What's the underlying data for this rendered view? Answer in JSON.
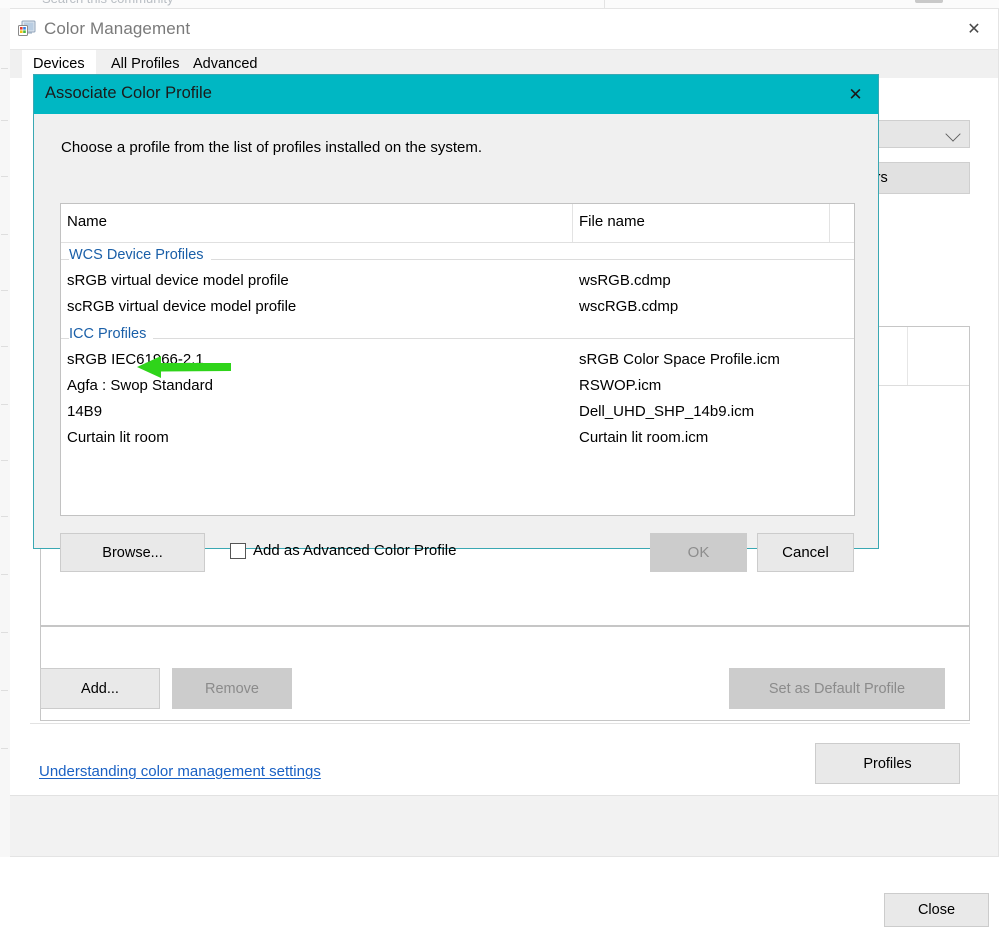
{
  "window": {
    "title": "Color Management",
    "app_icon": "color-monitor-icon",
    "close_label": "✕"
  },
  "tabs": [
    {
      "label": "Devices",
      "active": true
    },
    {
      "label": "All Profiles",
      "active": false
    },
    {
      "label": "Advanced",
      "active": false
    }
  ],
  "device_panel": {
    "identify_button": "nitors",
    "dropdown_value": ""
  },
  "actions": {
    "add": "Add...",
    "add_accel": "A",
    "remove": "Remove",
    "remove_accel": "R",
    "set_default": "Set as Default Profile",
    "set_default_accel": "S",
    "profiles": "Profiles",
    "profiles_accel": "r",
    "close": "Close"
  },
  "help_link": "Understanding color management settings",
  "dialog": {
    "title": "Associate Color Profile",
    "close_label": "✕",
    "prompt": "Choose a profile from the list of profiles installed on the system.",
    "columns": [
      "Name",
      "File name"
    ],
    "groups": [
      {
        "label": "WCS Device Profiles",
        "rows": [
          {
            "name": "sRGB virtual device model profile",
            "file": "wsRGB.cdmp"
          },
          {
            "name": "scRGB virtual device model profile",
            "file": "wscRGB.cdmp"
          }
        ]
      },
      {
        "label": "ICC Profiles",
        "rows": [
          {
            "name": "sRGB IEC61966-2.1",
            "file": "sRGB Color Space Profile.icm"
          },
          {
            "name": "Agfa : Swop Standard",
            "file": "RSWOP.icm"
          },
          {
            "name": "14B9",
            "file": "Dell_UHD_SHP_14b9.icm"
          },
          {
            "name": "Curtain lit room",
            "file": "Curtain lit room.icm"
          }
        ]
      }
    ],
    "browse": "Browse...",
    "advanced_checkbox_label": "Add as Advanced Color Profile",
    "advanced_checkbox_checked": false,
    "ok": "OK",
    "ok_enabled": false,
    "cancel": "Cancel"
  },
  "annotation": {
    "type": "arrow",
    "direction": "left",
    "color": "#2FD41A",
    "points_at": "14B9"
  },
  "colors": {
    "dialog_header": "#00B7C3",
    "link": "#1A61C4",
    "group_label": "#1A5FA8",
    "annotation_green": "#2FD41A"
  }
}
